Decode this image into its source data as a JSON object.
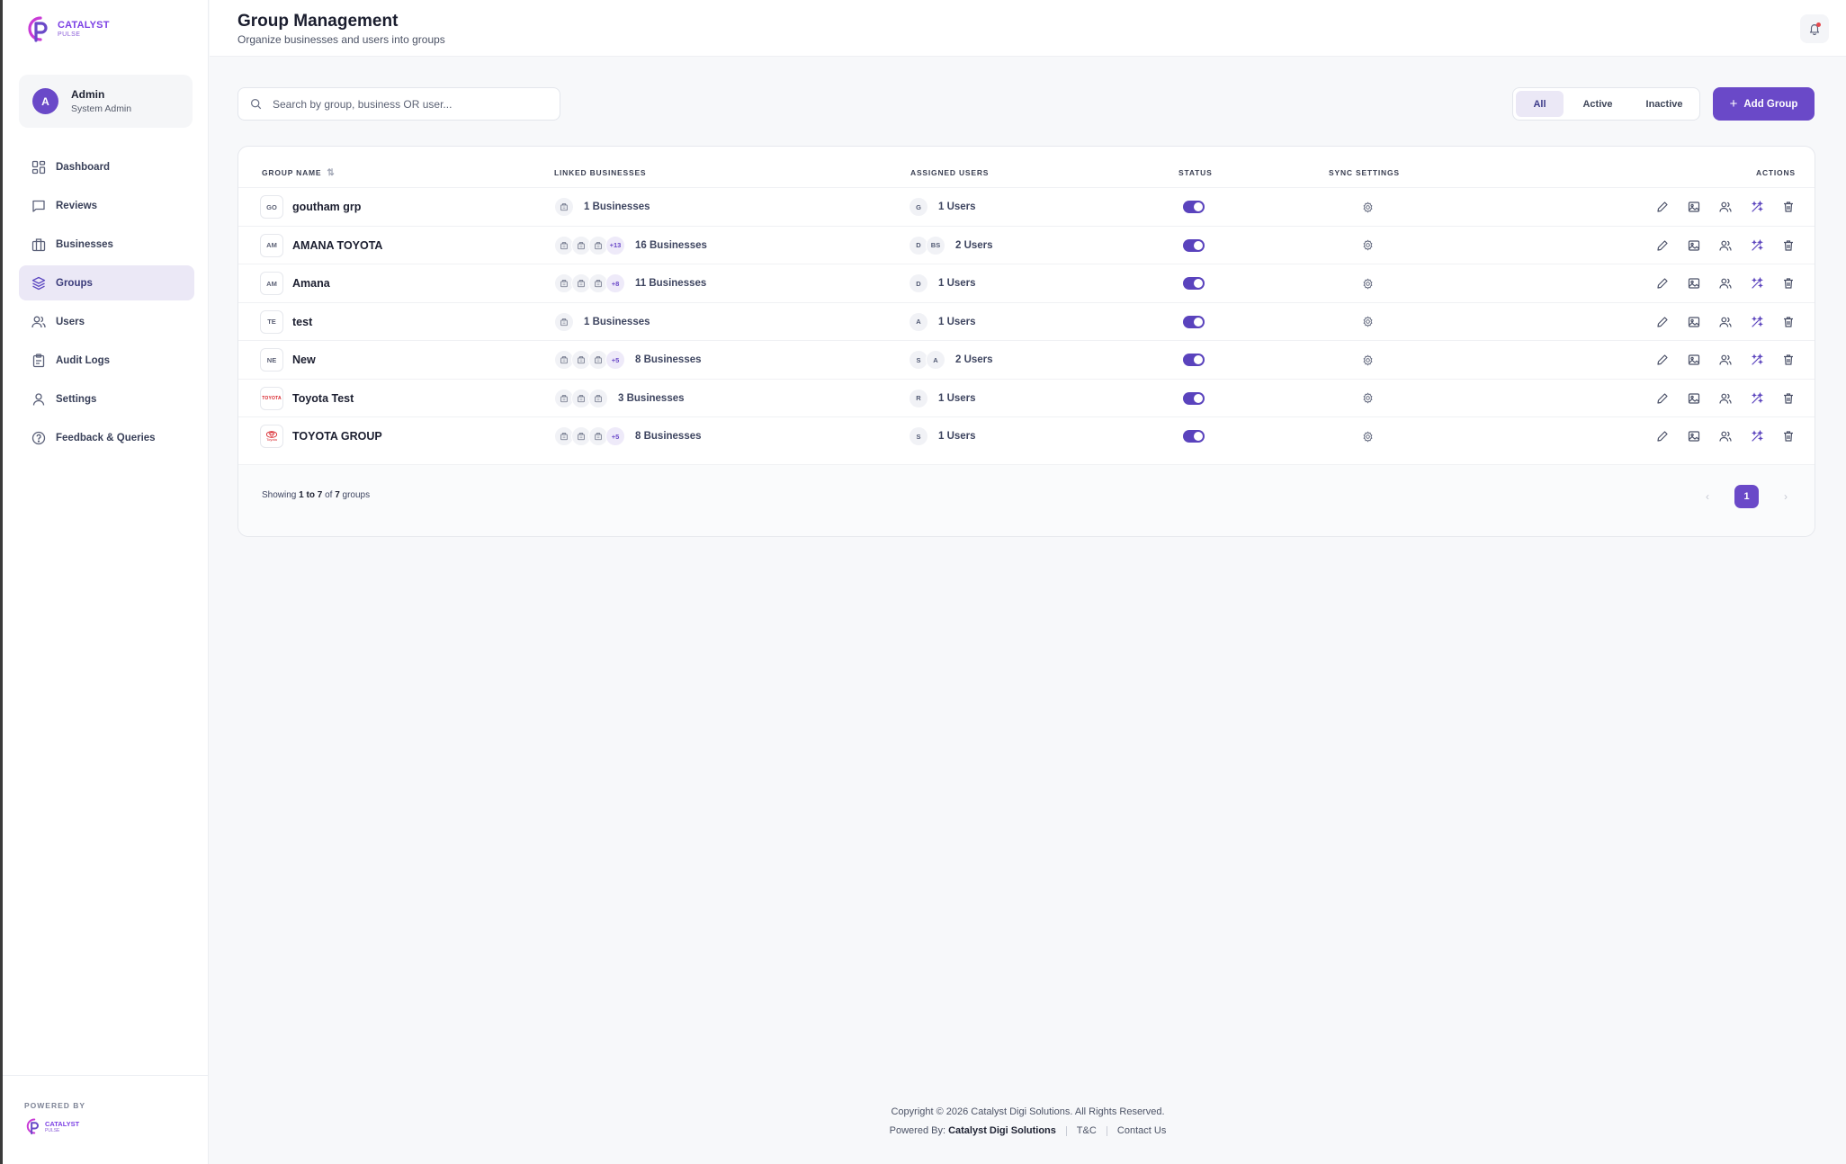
{
  "brand": {
    "name_line1": "CATALYST",
    "name_line2": "PULSE",
    "accent": "#6a49c8"
  },
  "user": {
    "initial": "A",
    "name": "Admin",
    "role": "System Admin"
  },
  "nav": [
    {
      "label": "Dashboard",
      "icon": "dashboard-icon"
    },
    {
      "label": "Reviews",
      "icon": "reviews-icon"
    },
    {
      "label": "Businesses",
      "icon": "businesses-icon"
    },
    {
      "label": "Groups",
      "icon": "groups-icon",
      "active": true
    },
    {
      "label": "Users",
      "icon": "users-icon"
    },
    {
      "label": "Audit Logs",
      "icon": "audit-logs-icon"
    },
    {
      "label": "Settings",
      "icon": "settings-icon"
    },
    {
      "label": "Feedback & Queries",
      "icon": "feedback-icon"
    }
  ],
  "powered_by": {
    "label": "POWERED BY",
    "line1": "CATALYST",
    "line2": "PULSE"
  },
  "header": {
    "title": "Group Management",
    "subtitle": "Organize businesses and users into groups"
  },
  "search": {
    "placeholder": "Search by group, business OR user...",
    "value": ""
  },
  "filters": [
    {
      "label": "All",
      "active": true
    },
    {
      "label": "Active",
      "active": false
    },
    {
      "label": "Inactive",
      "active": false
    }
  ],
  "add_button": {
    "label": "Add Group",
    "icon": "plus-icon"
  },
  "table": {
    "columns": [
      "GROUP NAME",
      "LINKED BUSINESSES",
      "ASSIGNED USERS",
      "STATUS",
      "SYNC SETTINGS",
      "ACTIONS"
    ],
    "rows": [
      {
        "badge": "GO",
        "name": "goutham grp",
        "biz_more": "",
        "biz_icons": 1,
        "biz_count": "1 Businesses",
        "users": [
          "G"
        ],
        "user_count": "1 Users",
        "status": true
      },
      {
        "badge": "AM",
        "name": "AMANA TOYOTA",
        "biz_more": "+13",
        "biz_icons": 3,
        "biz_count": "16 Businesses",
        "users": [
          "D",
          "BS"
        ],
        "user_count": "2 Users",
        "status": true
      },
      {
        "badge": "AM",
        "name": "Amana",
        "biz_more": "+8",
        "biz_icons": 3,
        "biz_count": "11 Businesses",
        "users": [
          "D"
        ],
        "user_count": "1 Users",
        "status": true
      },
      {
        "badge": "TE",
        "name": "test",
        "biz_more": "",
        "biz_icons": 1,
        "biz_count": "1 Businesses",
        "users": [
          "A"
        ],
        "user_count": "1 Users",
        "status": true
      },
      {
        "badge": "NE",
        "name": "New",
        "biz_more": "+5",
        "biz_icons": 3,
        "biz_count": "8 Businesses",
        "users": [
          "S",
          "A"
        ],
        "user_count": "2 Users",
        "status": true
      },
      {
        "badge": "TOYOTA",
        "logo": "toyota-text",
        "name": "Toyota Test",
        "biz_more": "",
        "biz_icons": 3,
        "biz_count": "3 Businesses",
        "users": [
          "R"
        ],
        "user_count": "1 Users",
        "status": true
      },
      {
        "badge": "Toyota",
        "logo": "toyota-emblem",
        "name": "TOYOTA GROUP",
        "biz_more": "+5",
        "biz_icons": 3,
        "biz_count": "8 Businesses",
        "users": [
          "S"
        ],
        "user_count": "1 Users",
        "status": true
      }
    ]
  },
  "pagination": {
    "showing_prefix": "Showing",
    "from": "1",
    "to_word": "to",
    "to": "7",
    "of_word": "of",
    "total": "7",
    "unit": "groups",
    "current_page": "1"
  },
  "footer": {
    "copyright": "Copyright © 2026 Catalyst Digi Solutions. All Rights Reserved.",
    "powered_prefix": "Powered By:",
    "powered_name": "Catalyst Digi Solutions",
    "tc": "T&C",
    "contact": "Contact Us"
  }
}
